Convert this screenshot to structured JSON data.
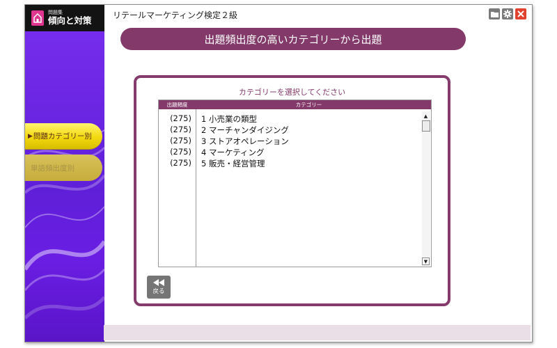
{
  "logo": {
    "subtitle": "問題集",
    "title": "傾向と対策"
  },
  "app_title": "リテールマーケティング検定２級",
  "sidebar": {
    "items": [
      {
        "label": "問題カテゴリー別",
        "active": true
      },
      {
        "label": "単語頻出度別",
        "active": false
      }
    ]
  },
  "banner": "出題頻出度の高いカテゴリーから出題",
  "panel": {
    "title": "カテゴリーを選択してください",
    "columns": {
      "frequency": "出題頻度",
      "category": "カテゴリー"
    },
    "rows": [
      {
        "freq": "(275)",
        "category": "1 小売業の類型"
      },
      {
        "freq": "(275)",
        "category": "2 マーチャンダイジング"
      },
      {
        "freq": "(275)",
        "category": "3 ストアオペレーション"
      },
      {
        "freq": "(275)",
        "category": "4 マーケティング"
      },
      {
        "freq": "(275)",
        "category": "5 販売・経営管理"
      }
    ]
  },
  "back_button": {
    "label": "戻る"
  },
  "colors": {
    "accent": "#833a6a",
    "sidebar_purple": "#6a22e0",
    "active_tab": "#f2d90f",
    "close": "#e1412f"
  },
  "icons": [
    "home-icon",
    "folder-icon",
    "gear-icon",
    "close-icon",
    "rewind-icon",
    "scroll-up-icon",
    "scroll-down-icon"
  ]
}
